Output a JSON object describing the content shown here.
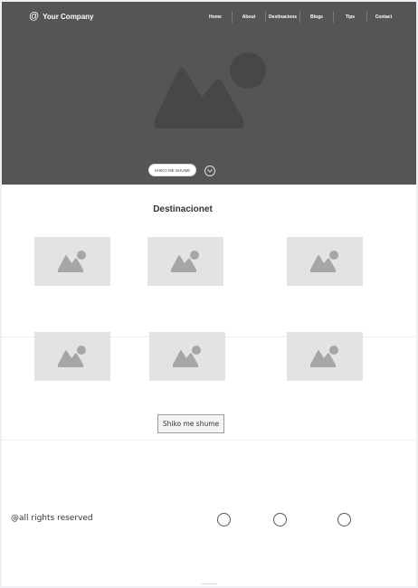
{
  "header": {
    "brand": "Your Company",
    "brand_symbol": "@",
    "nav": [
      "Home",
      "About",
      "Destinacions",
      "Blogs",
      "Tips",
      "Contact"
    ]
  },
  "hero": {
    "cta_label": "SHIKO ME SHUME",
    "image_icon": "image-placeholder-icon",
    "scroll_icon": "chevron-down-icon"
  },
  "destinations": {
    "title": "Destinacionet",
    "items": [
      "image-placeholder",
      "image-placeholder",
      "image-placeholder",
      "image-placeholder",
      "image-placeholder",
      "image-placeholder"
    ],
    "more_label": "Shiko me shume"
  },
  "footer": {
    "rights": "@all rights reserved",
    "social_icons": [
      "social-icon",
      "social-icon",
      "social-icon"
    ]
  },
  "colors": {
    "hero_bg": "#555555",
    "placeholder_bg": "#e3e3e3",
    "placeholder_icon": "#a6a6a6",
    "hero_icon": "#474747"
  }
}
